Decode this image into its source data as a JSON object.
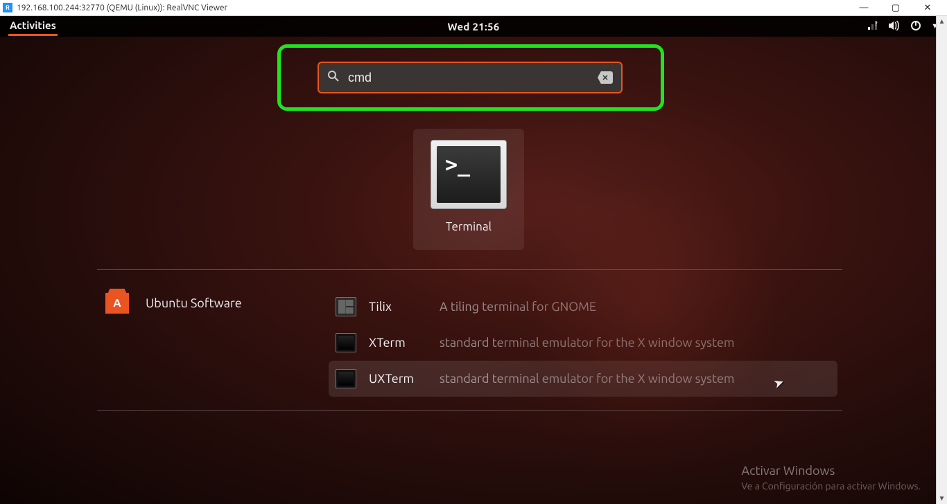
{
  "window": {
    "title": "192.168.100.244:32770 (QEMU (Linux)): RealVNC Viewer"
  },
  "topbar": {
    "activities": "Activities",
    "clock": "Wed 21:56"
  },
  "search": {
    "value": "cmd"
  },
  "app_result": {
    "label": "Terminal",
    "prompt": ">_"
  },
  "category": {
    "label": "Ubuntu Software"
  },
  "software_results": [
    {
      "name": "Tilix",
      "desc": "A tiling terminal for GNOME",
      "icon": "tilix",
      "hover": false
    },
    {
      "name": "XTerm",
      "desc": "standard terminal emulator for the X window system",
      "icon": "xt",
      "hover": false
    },
    {
      "name": "UXTerm",
      "desc": "standard terminal emulator for the X window system",
      "icon": "xt",
      "hover": true
    }
  ],
  "watermark": {
    "line1": "Activar Windows",
    "line2": "Ve a Configuración para activar Windows."
  }
}
